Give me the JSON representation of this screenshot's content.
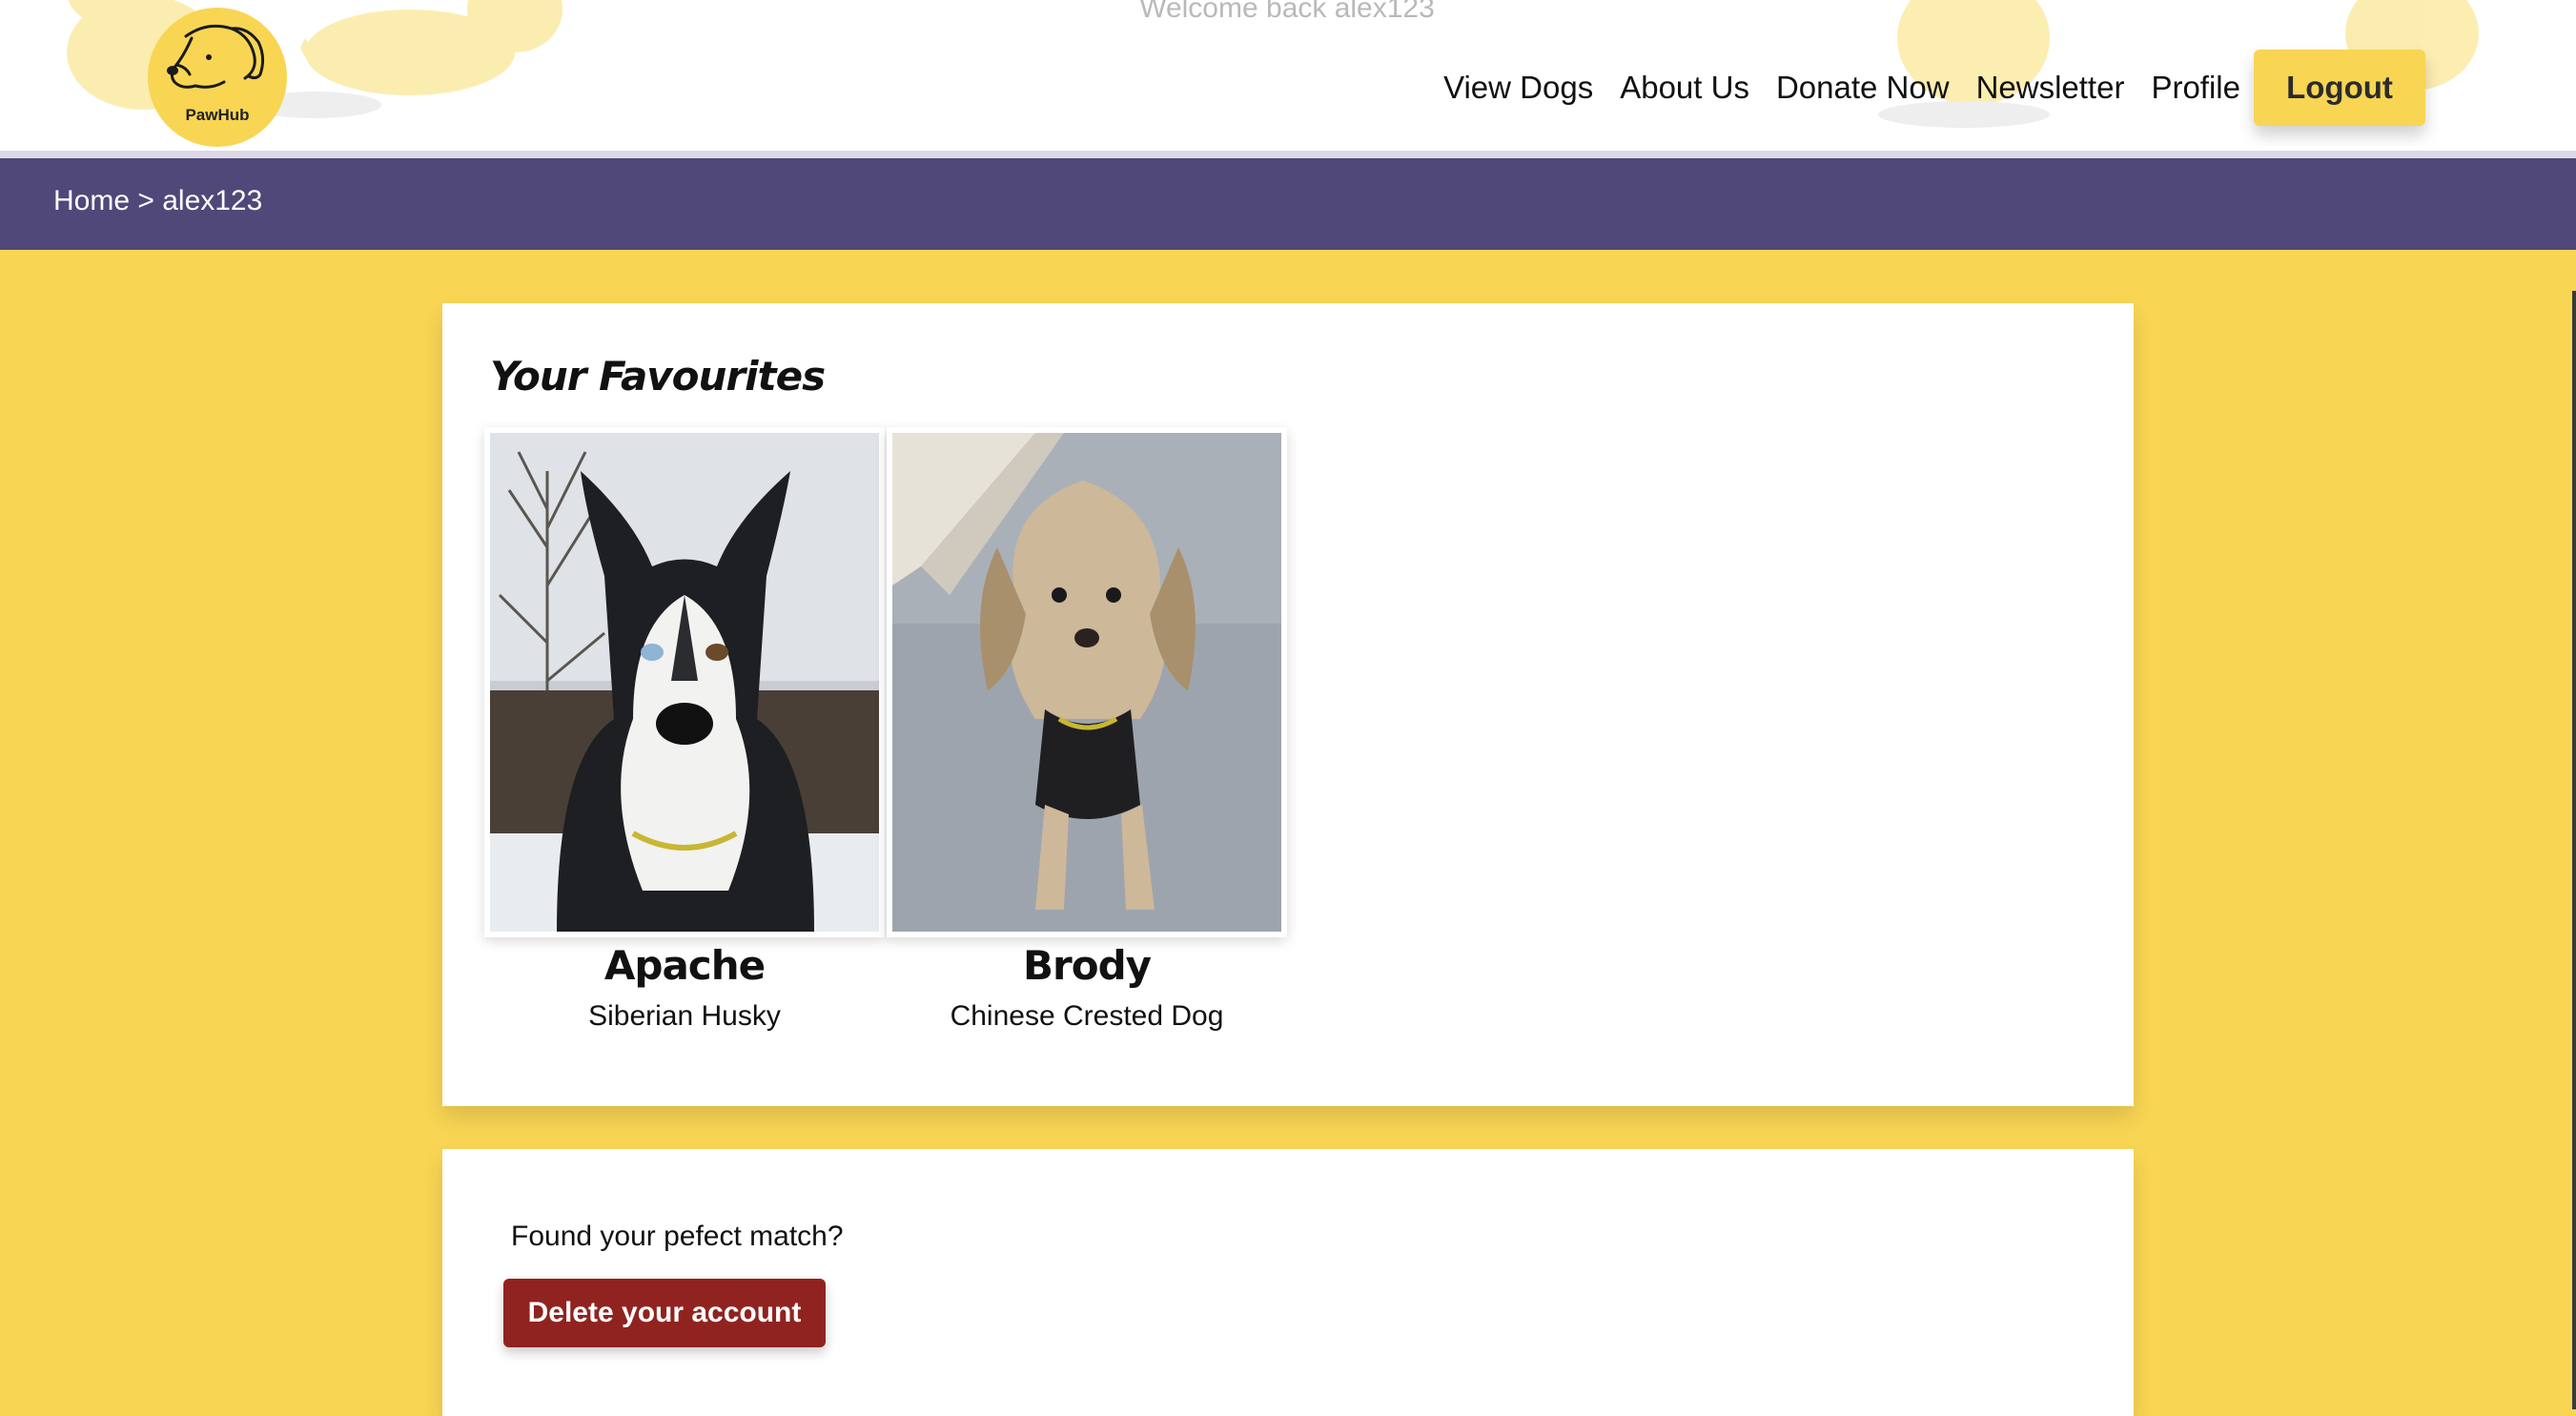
{
  "header": {
    "brand": "PawHub",
    "welcome": "Welcome back alex123",
    "nav": [
      "View Dogs",
      "About Us",
      "Donate Now",
      "Newsletter",
      "Profile"
    ],
    "logout_label": "Logout"
  },
  "breadcrumb": "Home > alex123",
  "favourites": {
    "title": "Your Favourites",
    "dogs": [
      {
        "name": "Apache",
        "breed": "Siberian Husky"
      },
      {
        "name": "Brody",
        "breed": "Chinese Crested Dog"
      }
    ]
  },
  "match": {
    "prompt": "Found your pefect match?",
    "delete_label": "Delete your account"
  },
  "colors": {
    "primary_yellow": "#f8d553",
    "breadcrumb_purple": "#4f4879",
    "delete_red": "#90231f",
    "card_white": "#ffffff"
  },
  "icons": {
    "logo": "dog-head-icon"
  }
}
